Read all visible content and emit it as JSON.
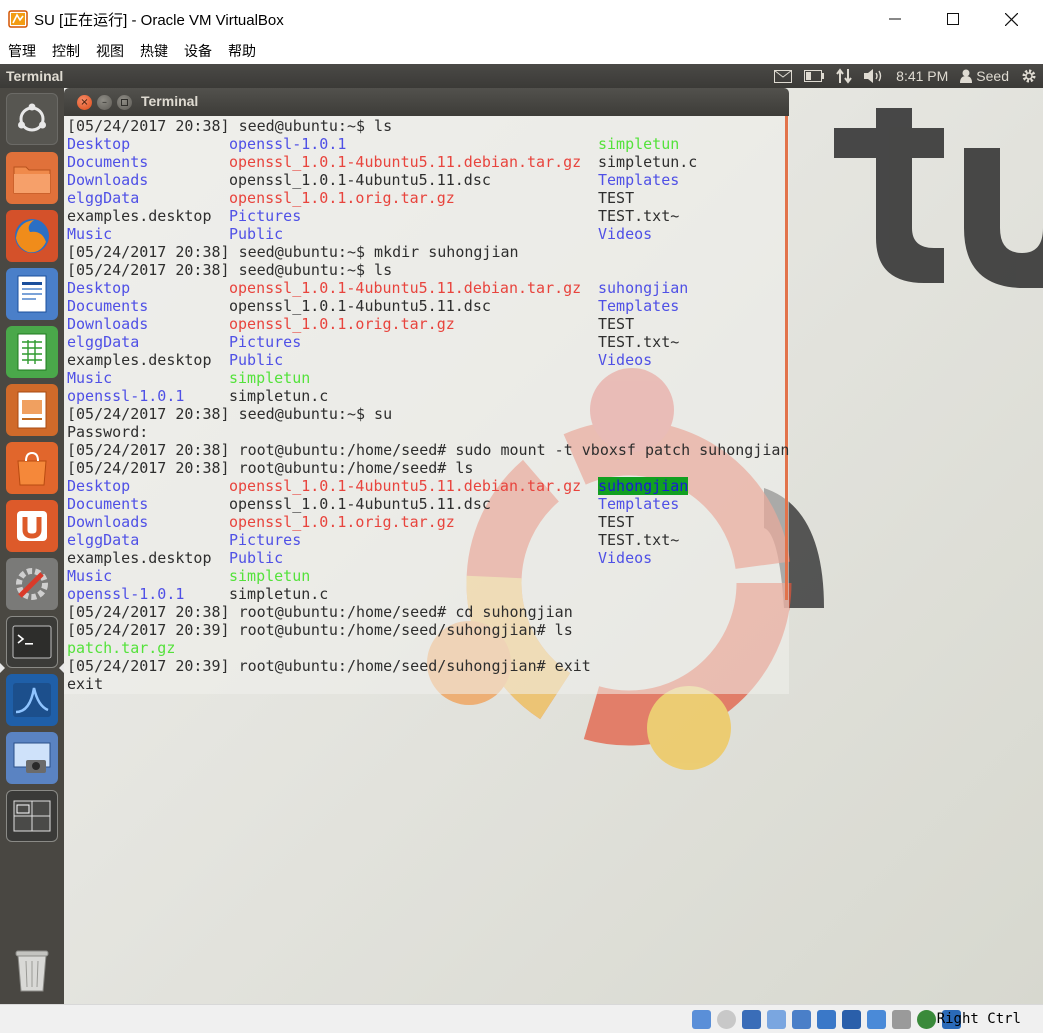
{
  "host": {
    "title": "SU [正在运行] - Oracle VM VirtualBox",
    "menu": [
      "管理",
      "控制",
      "视图",
      "热键",
      "设备",
      "帮助"
    ],
    "host_key": "Right Ctrl"
  },
  "panel": {
    "app_title": "Terminal",
    "time": "8:41 PM",
    "user": "Seed"
  },
  "launcher": {
    "items": [
      "dash-home",
      "files",
      "firefox",
      "libreoffice-writer",
      "libreoffice-calc",
      "libreoffice-impress",
      "ubuntu-software-center",
      "ubuntu-one",
      "system-settings",
      "terminal",
      "wireshark",
      "screenshot",
      "workspace-switcher",
      "trash"
    ]
  },
  "terminal": {
    "title": "Terminal",
    "lines": [
      {
        "cols": [
          {
            "t": "[05/24/2017 20:38] seed@ubuntu:~$ ls",
            "k": "plain"
          }
        ]
      },
      {
        "cols": [
          {
            "t": "Desktop",
            "k": "dir"
          },
          {
            "t": "openssl-1.0.1",
            "k": "dir"
          },
          {
            "t": "simpletun",
            "k": "exe"
          }
        ]
      },
      {
        "cols": [
          {
            "t": "Documents",
            "k": "dir"
          },
          {
            "t": "openssl_1.0.1-4ubuntu5.11.debian.tar.gz",
            "k": "arc"
          },
          {
            "t": "simpletun.c",
            "k": "plain"
          }
        ]
      },
      {
        "cols": [
          {
            "t": "Downloads",
            "k": "dir"
          },
          {
            "t": "openssl_1.0.1-4ubuntu5.11.dsc",
            "k": "plain"
          },
          {
            "t": "Templates",
            "k": "dir"
          }
        ]
      },
      {
        "cols": [
          {
            "t": "elggData",
            "k": "dir"
          },
          {
            "t": "openssl_1.0.1.orig.tar.gz",
            "k": "arc"
          },
          {
            "t": "TEST",
            "k": "plain"
          }
        ]
      },
      {
        "cols": [
          {
            "t": "examples.desktop",
            "k": "plain"
          },
          {
            "t": "Pictures",
            "k": "dir"
          },
          {
            "t": "TEST.txt~",
            "k": "plain"
          }
        ]
      },
      {
        "cols": [
          {
            "t": "Music",
            "k": "dir"
          },
          {
            "t": "Public",
            "k": "dir"
          },
          {
            "t": "Videos",
            "k": "dir"
          }
        ]
      },
      {
        "cols": [
          {
            "t": "[05/24/2017 20:38] seed@ubuntu:~$ mkdir suhongjian",
            "k": "plain"
          }
        ]
      },
      {
        "cols": [
          {
            "t": "[05/24/2017 20:38] seed@ubuntu:~$ ls",
            "k": "plain"
          }
        ]
      },
      {
        "cols": [
          {
            "t": "Desktop",
            "k": "dir"
          },
          {
            "t": "openssl_1.0.1-4ubuntu5.11.debian.tar.gz",
            "k": "arc"
          },
          {
            "t": "suhongjian",
            "k": "dir"
          }
        ]
      },
      {
        "cols": [
          {
            "t": "Documents",
            "k": "dir"
          },
          {
            "t": "openssl_1.0.1-4ubuntu5.11.dsc",
            "k": "plain"
          },
          {
            "t": "Templates",
            "k": "dir"
          }
        ]
      },
      {
        "cols": [
          {
            "t": "Downloads",
            "k": "dir"
          },
          {
            "t": "openssl_1.0.1.orig.tar.gz",
            "k": "arc"
          },
          {
            "t": "TEST",
            "k": "plain"
          }
        ]
      },
      {
        "cols": [
          {
            "t": "elggData",
            "k": "dir"
          },
          {
            "t": "Pictures",
            "k": "dir"
          },
          {
            "t": "TEST.txt~",
            "k": "plain"
          }
        ]
      },
      {
        "cols": [
          {
            "t": "examples.desktop",
            "k": "plain"
          },
          {
            "t": "Public",
            "k": "dir"
          },
          {
            "t": "Videos",
            "k": "dir"
          }
        ]
      },
      {
        "cols": [
          {
            "t": "Music",
            "k": "dir"
          },
          {
            "t": "simpletun",
            "k": "exe"
          }
        ]
      },
      {
        "cols": [
          {
            "t": "openssl-1.0.1",
            "k": "dir"
          },
          {
            "t": "simpletun.c",
            "k": "plain"
          }
        ]
      },
      {
        "cols": [
          {
            "t": "[05/24/2017 20:38] seed@ubuntu:~$ su",
            "k": "plain"
          }
        ]
      },
      {
        "cols": [
          {
            "t": "Password:",
            "k": "plain"
          }
        ]
      },
      {
        "cols": [
          {
            "t": "[05/24/2017 20:38] root@ubuntu:/home/seed# sudo mount -t vboxsf patch suhongjian",
            "k": "plain"
          }
        ]
      },
      {
        "cols": [
          {
            "t": "[05/24/2017 20:38] root@ubuntu:/home/seed# ls",
            "k": "plain"
          }
        ]
      },
      {
        "cols": [
          {
            "t": "Desktop",
            "k": "dir"
          },
          {
            "t": "openssl_1.0.1-4ubuntu5.11.debian.tar.gz",
            "k": "arc"
          },
          {
            "t": "suhongjian",
            "k": "hl"
          }
        ]
      },
      {
        "cols": [
          {
            "t": "Documents",
            "k": "dir"
          },
          {
            "t": "openssl_1.0.1-4ubuntu5.11.dsc",
            "k": "plain"
          },
          {
            "t": "Templates",
            "k": "dir"
          }
        ]
      },
      {
        "cols": [
          {
            "t": "Downloads",
            "k": "dir"
          },
          {
            "t": "openssl_1.0.1.orig.tar.gz",
            "k": "arc"
          },
          {
            "t": "TEST",
            "k": "plain"
          }
        ]
      },
      {
        "cols": [
          {
            "t": "elggData",
            "k": "dir"
          },
          {
            "t": "Pictures",
            "k": "dir"
          },
          {
            "t": "TEST.txt~",
            "k": "plain"
          }
        ]
      },
      {
        "cols": [
          {
            "t": "examples.desktop",
            "k": "plain"
          },
          {
            "t": "Public",
            "k": "dir"
          },
          {
            "t": "Videos",
            "k": "dir"
          }
        ]
      },
      {
        "cols": [
          {
            "t": "Music",
            "k": "dir"
          },
          {
            "t": "simpletun",
            "k": "exe"
          }
        ]
      },
      {
        "cols": [
          {
            "t": "openssl-1.0.1",
            "k": "dir"
          },
          {
            "t": "simpletun.c",
            "k": "plain"
          }
        ]
      },
      {
        "cols": [
          {
            "t": "[05/24/2017 20:38] root@ubuntu:/home/seed# cd suhongjian",
            "k": "plain"
          }
        ]
      },
      {
        "cols": [
          {
            "t": "[05/24/2017 20:39] root@ubuntu:/home/seed/suhongjian# ls",
            "k": "plain"
          }
        ]
      },
      {
        "cols": [
          {
            "t": "patch.tar.gz",
            "k": "exe"
          }
        ]
      },
      {
        "cols": [
          {
            "t": "[05/24/2017 20:39] root@ubuntu:/home/seed/suhongjian# exit",
            "k": "plain"
          }
        ]
      },
      {
        "cols": [
          {
            "t": "exit",
            "k": "plain"
          }
        ]
      }
    ]
  },
  "colors": {
    "directory": "#4f50e6",
    "archive": "#e8443d",
    "executable": "#54e23b",
    "highlight_bg": "#12a021",
    "accent_orange": "#e2734b"
  }
}
